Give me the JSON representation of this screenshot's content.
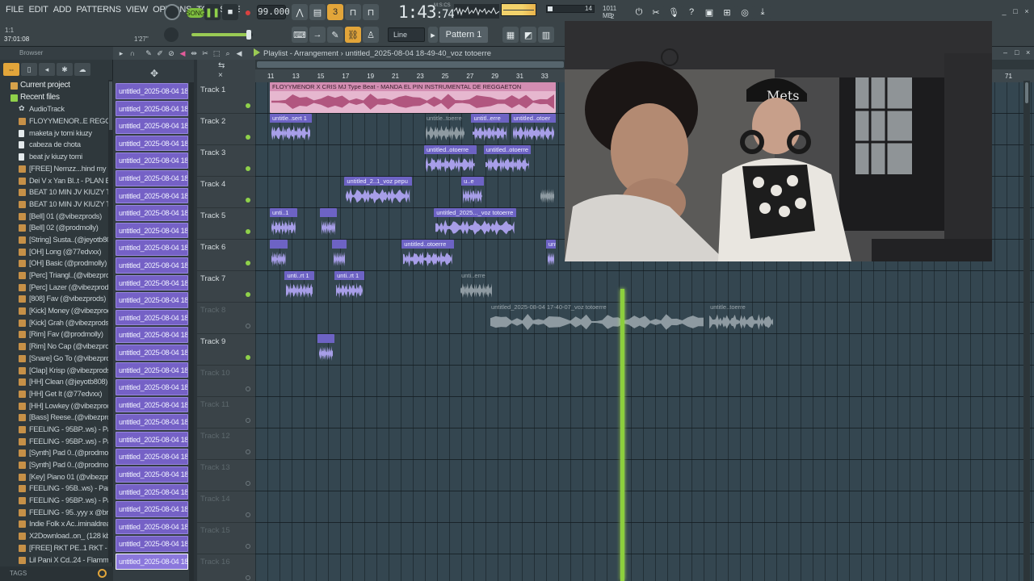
{
  "menu": [
    "FILE",
    "EDIT",
    "ADD",
    "PATTERNS",
    "VIEW",
    "OPTIONS",
    "TOOLS",
    "HELP"
  ],
  "transport": {
    "song_label": "SONG",
    "tempo": "99.000",
    "time": "1:43",
    "time_sub": ":74",
    "msc_label": "M:S:CS",
    "cpu_value": "14",
    "memory": "1011 MB",
    "voices": "2"
  },
  "hint": {
    "top": "1:1",
    "left": "37:01:08",
    "right": "1'27\""
  },
  "toolbar": {
    "snap": "Line",
    "pattern": "Pattern 1"
  },
  "browser": {
    "title": "Browser",
    "current_project": "Current project",
    "recent_files": "Recent files",
    "items": [
      {
        "icon": "star",
        "label": "AudioTrack"
      },
      {
        "icon": "wav",
        "label": "FLOYYMENOR..E REGGAETON"
      },
      {
        "icon": "flp",
        "label": "maketa jv tomi kiuzy"
      },
      {
        "icon": "flp",
        "label": "cabeza de chota"
      },
      {
        "icon": "flp",
        "label": "beat jv kiuzy tomi"
      },
      {
        "icon": "wav",
        "label": "[FREE] Nemzz...hind my Back"
      },
      {
        "icon": "wav",
        "label": "Dei V x Yan Bl..t - PLAN B (1)"
      },
      {
        "icon": "wav",
        "label": "BEAT 10 MIN JV KIUZY  TOMI"
      },
      {
        "icon": "wav",
        "label": "BEAT 10 MIN JV KIUZY  TOMI"
      },
      {
        "icon": "wav",
        "label": "[Bell] 01 (@vibezprods)"
      },
      {
        "icon": "wav",
        "label": "[Bell] 02 (@prodmolly)"
      },
      {
        "icon": "wav",
        "label": "[String] Susta..(@jeyotb808)"
      },
      {
        "icon": "wav",
        "label": "[OH] Long (@77edvxx)"
      },
      {
        "icon": "wav",
        "label": "[OH] Basic (@prodmolly)"
      },
      {
        "icon": "wav",
        "label": "[Perc] Triangl..(@vibezprods)"
      },
      {
        "icon": "wav",
        "label": "[Perc] Lazer (@vibezprods)"
      },
      {
        "icon": "wav",
        "label": "[808] Fav (@vibezprods)"
      },
      {
        "icon": "wav",
        "label": "[Kick] Money (@vibezprods)"
      },
      {
        "icon": "wav",
        "label": "[Kick] Grah (@vibezprods)"
      },
      {
        "icon": "wav",
        "label": "[Rim] Fav (@prodmolly)"
      },
      {
        "icon": "wav",
        "label": "[Rim] No Cap (@vibezprods)"
      },
      {
        "icon": "wav",
        "label": "[Snare] Go To (@vibezprods)"
      },
      {
        "icon": "wav",
        "label": "[Clap] Krisp (@vibezprods)"
      },
      {
        "icon": "wav",
        "label": "[HH] Clean (@jeyotb808)"
      },
      {
        "icon": "wav",
        "label": "[HH] Get It (@77edvxx)"
      },
      {
        "icon": "wav",
        "label": "[HH] Lowkey (@vibezprods)"
      },
      {
        "icon": "wav",
        "label": "[Bass] Reese..(@vibezprods)"
      },
      {
        "icon": "wav",
        "label": "FEELING - 95BP..ws) - Part_4"
      },
      {
        "icon": "wav",
        "label": "FEELING - 95BP..ws) - Part_3"
      },
      {
        "icon": "wav",
        "label": "[Synth] Pad 0..(@prodmolly)"
      },
      {
        "icon": "wav",
        "label": "[Synth] Pad 0..(@prodmolly)"
      },
      {
        "icon": "wav",
        "label": "[Key] Piano 01 (@vibezprods)"
      },
      {
        "icon": "wav",
        "label": "FEELING - 95B..ws) - Part_2"
      },
      {
        "icon": "wav",
        "label": "FEELING - 95BP..ws) - Part_1"
      },
      {
        "icon": "wav",
        "label": "FEELING - 95..yyy x @bravs)"
      },
      {
        "icon": "wav",
        "label": "Indie Folk x Ac..iminaldream"
      },
      {
        "icon": "wav",
        "label": "X2Download..on_ (128 kbps)"
      },
      {
        "icon": "wav",
        "label": "[FREE] RKT PE..1 RKT - B side"
      },
      {
        "icon": "wav",
        "label": "Lil Pani X Cd..24 - FlammelCP"
      }
    ],
    "tags": "TAGS"
  },
  "clip_picker": {
    "clips": [
      "untitled_2025-08-04 18-",
      "untitled_2025-08-04 18-",
      "untitled_2025-08-04 18-",
      "untitled_2025-08-04 18-",
      "untitled_2025-08-04 18-",
      "untitled_2025-08-04 18-",
      "untitled_2025-08-04 18-",
      "untitled_2025-08-04 18-",
      "untitled_2025-08-04 18-",
      "untitled_2025-08-04 18-",
      "untitled_2025-08-04 18-",
      "untitled_2025-08-04 18-",
      "untitled_2025-08-04 18-",
      "untitled_2025-08-04 18-",
      "untitled_2025-08-04 18-",
      "untitled_2025-08-04 18-",
      "untitled_2025-08-04 18-",
      "untitled_2025-08-04 18-",
      "untitled_2025-08-04 18-",
      "untitled_2025-08-04 18-",
      "untitled_2025-08-04 18-",
      "untitled_2025-08-04 18-",
      "untitled_2025-08-04 18-",
      "untitled_2025-08-04 18-",
      "untitled_2025-08-04 18-",
      "untitled_2025-08-04 18-",
      "untitled_2025-08-04 18-",
      "untitled_2025-08-04 18-"
    ]
  },
  "playlist": {
    "title": "Playlist - Arrangement",
    "breadcrumb": "untitled_2025-08-04 18-49-40_voz totoerre",
    "ruler": [
      "11",
      "13",
      "15",
      "17",
      "19",
      "21",
      "23",
      "25",
      "27",
      "29",
      "31",
      "33"
    ],
    "ruler_far": "71",
    "tracks": [
      {
        "name": "Track 1",
        "active": true
      },
      {
        "name": "Track 2",
        "active": true
      },
      {
        "name": "Track 3",
        "active": true
      },
      {
        "name": "Track 4",
        "active": true
      },
      {
        "name": "Track 5",
        "active": true
      },
      {
        "name": "Track 6",
        "active": true
      },
      {
        "name": "Track 7",
        "active": true
      },
      {
        "name": "Track 8",
        "active": false
      },
      {
        "name": "Track 9",
        "active": true
      },
      {
        "name": "Track 10",
        "active": false
      },
      {
        "name": "Track 11",
        "active": false
      },
      {
        "name": "Track 12",
        "active": false
      },
      {
        "name": "Track 13",
        "active": false
      },
      {
        "name": "Track 14",
        "active": false
      },
      {
        "name": "Track 15",
        "active": false
      },
      {
        "name": "Track 16",
        "active": false
      }
    ],
    "clips": [
      {
        "track": 0,
        "start": 11,
        "end": 34,
        "label": "FLOYYMENOR X CRIS MJ Type Beat - MANDA EL PIN  INSTRUMENTAL DE REGGAETON",
        "style": "beat"
      },
      {
        "track": 1,
        "start": 11,
        "end": 14.4,
        "label": "untitle..sert 1",
        "style": "audio"
      },
      {
        "track": 1,
        "start": 23.4,
        "end": 26.8,
        "label": "untitle..toerre",
        "style": "ghost"
      },
      {
        "track": 1,
        "start": 27.2,
        "end": 30.2,
        "label": "untitl..erre",
        "style": "audio"
      },
      {
        "track": 1,
        "start": 30.4,
        "end": 34,
        "label": "untitled..otoer",
        "style": "audio"
      },
      {
        "track": 2,
        "start": 23.4,
        "end": 27.6,
        "label": "untitled..otoerre",
        "style": "audio"
      },
      {
        "track": 2,
        "start": 28.2,
        "end": 32,
        "label": "untitled..otoerre",
        "style": "audio"
      },
      {
        "track": 3,
        "start": 17,
        "end": 22.4,
        "label": "untitled_2..1_voz pepu",
        "style": "audio"
      },
      {
        "track": 3,
        "start": 26.4,
        "end": 28.2,
        "label": "u..e",
        "style": "audio"
      },
      {
        "track": 3,
        "start": 32.6,
        "end": 34,
        "label": "",
        "style": "ghost"
      },
      {
        "track": 4,
        "start": 11,
        "end": 13.2,
        "label": "unti..1",
        "style": "audio"
      },
      {
        "track": 4,
        "start": 15,
        "end": 16.4,
        "label": "",
        "style": "audio"
      },
      {
        "track": 4,
        "start": 24.2,
        "end": 30.8,
        "label": "untitled_2025..._voz totoerre",
        "style": "audio"
      },
      {
        "track": 5,
        "start": 11,
        "end": 12.4,
        "label": "",
        "style": "audio"
      },
      {
        "track": 5,
        "start": 16,
        "end": 17.2,
        "label": "",
        "style": "audio"
      },
      {
        "track": 5,
        "start": 21.6,
        "end": 25.8,
        "label": "untitled..otoerre",
        "style": "audio"
      },
      {
        "track": 5,
        "start": 33.2,
        "end": 34,
        "label": "untitled",
        "style": "audio"
      },
      {
        "track": 6,
        "start": 12.2,
        "end": 14.6,
        "label": "unti..rt 1",
        "style": "audio"
      },
      {
        "track": 6,
        "start": 16.2,
        "end": 18.6,
        "label": "unti..rt 1",
        "style": "audio"
      },
      {
        "track": 6,
        "start": 26.2,
        "end": 29,
        "label": "unti..erre",
        "style": "ghost"
      },
      {
        "track": 7,
        "start": 28.6,
        "end": 46,
        "label": "untitled_2025-08-04 17-40-07_voz totoerre",
        "style": "ghost"
      },
      {
        "track": 7,
        "start": 46.2,
        "end": 51.6,
        "label": "untitle..toerre",
        "style": "ghost"
      },
      {
        "track": 8,
        "start": 14.8,
        "end": 16.2,
        "label": "",
        "style": "audio"
      }
    ],
    "playhead_bar": 39.2
  },
  "window_controls": [
    "_",
    "□",
    "×"
  ],
  "colors": {
    "accent": "#e2a53a",
    "playhead": "#8ccf3d",
    "clip": "#7561c6",
    "beat_clip": "#e6b7cf"
  }
}
